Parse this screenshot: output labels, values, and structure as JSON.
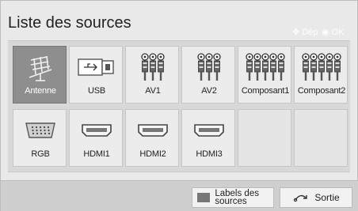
{
  "header": {
    "title": "Liste des sources",
    "hint_move": "Dép",
    "hint_ok": "OK"
  },
  "sources": [
    {
      "label": "Antenne",
      "icon": "antenna-icon",
      "selected": true
    },
    {
      "label": "USB",
      "icon": "usb-icon",
      "selected": false
    },
    {
      "label": "AV1",
      "icon": "av-connector-icon",
      "selected": false
    },
    {
      "label": "AV2",
      "icon": "av-connector-icon",
      "selected": false
    },
    {
      "label": "Composant1",
      "icon": "component-connector-icon",
      "selected": false
    },
    {
      "label": "Composant2",
      "icon": "component-connector-icon",
      "selected": false
    },
    {
      "label": "RGB",
      "icon": "vga-port-icon",
      "selected": false
    },
    {
      "label": "HDMI1",
      "icon": "hdmi-port-icon",
      "selected": false
    },
    {
      "label": "HDMI2",
      "icon": "hdmi-port-icon",
      "selected": false
    },
    {
      "label": "HDMI3",
      "icon": "hdmi-port-icon",
      "selected": false
    },
    {
      "label": "",
      "icon": "",
      "selected": false
    },
    {
      "label": "",
      "icon": "",
      "selected": false
    }
  ],
  "footer": {
    "labels_button": "Labels des sources",
    "exit_button": "Sortie"
  },
  "colors": {
    "selected_tile": "#8e8e8e",
    "panel_bg": "#e9e9e9"
  }
}
